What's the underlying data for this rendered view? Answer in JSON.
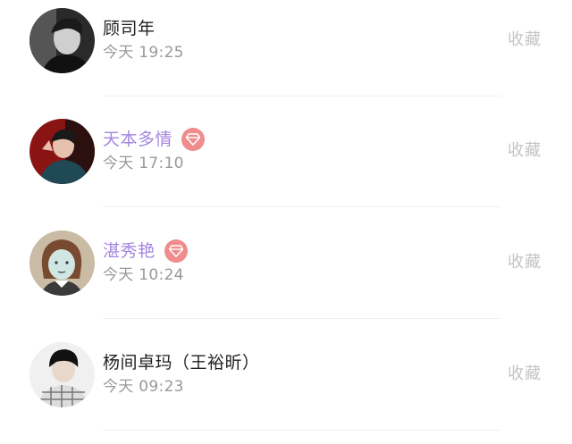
{
  "entries": [
    {
      "name": "顾司年",
      "vip": false,
      "time": "今天 19:25",
      "action": "收藏",
      "avatar_icon": "portrait-photo-icon"
    },
    {
      "name": "天本多情",
      "vip": true,
      "time": "今天 17:10",
      "action": "收藏",
      "avatar_icon": "portrait-photo-icon"
    },
    {
      "name": "湛秀艳",
      "vip": true,
      "time": "今天 10:24",
      "action": "收藏",
      "avatar_icon": "cartoon-portrait-icon"
    },
    {
      "name": "杨间卓玛（王裕昕）",
      "vip": false,
      "time": "今天 09:23",
      "action": "收藏",
      "avatar_icon": "portrait-photo-icon"
    }
  ],
  "colors": {
    "vip_name": "#a486e0",
    "normal_name": "#222222",
    "time": "#999999",
    "action": "#c4c4c4",
    "vip_badge": "#ef8c8c"
  }
}
